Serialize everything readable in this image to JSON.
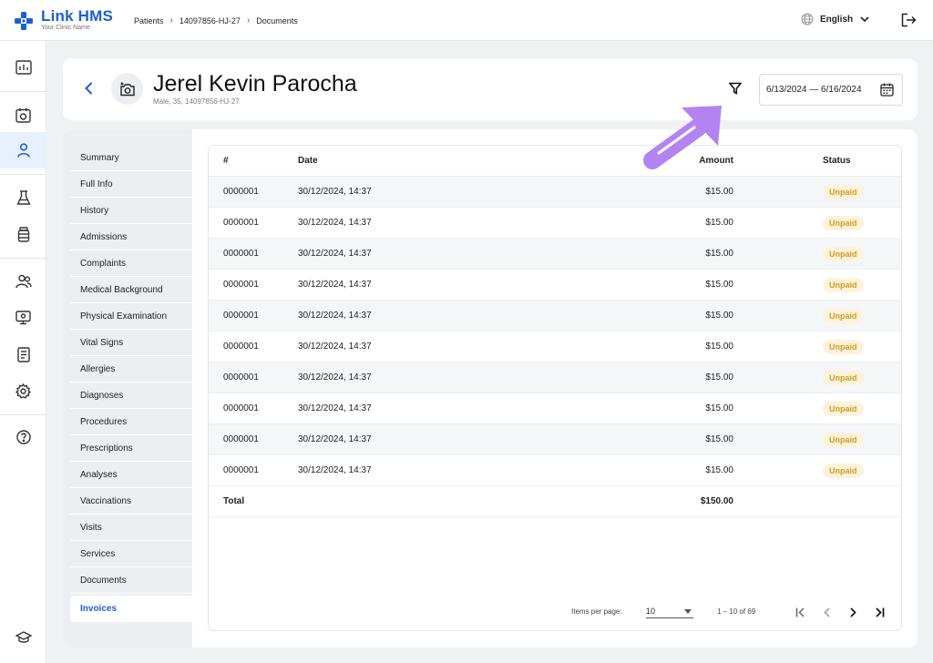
{
  "app": {
    "name": "Link HMS",
    "subtitle": "Your Clinic Name",
    "brand_color": "#1c5fd4"
  },
  "breadcrumb": [
    "Patients",
    "14097856-HJ-27",
    "Documents"
  ],
  "language": "English",
  "patient": {
    "name": "Jerel Kevin Parocha",
    "meta": "Male, 35, 14097856-HJ-27"
  },
  "date_range": "6/13/2024 — 6/16/2024",
  "sidebar": [
    "dashboard-icon",
    "calendar-icon",
    "user-icon",
    "lab-flask-icon",
    "medicine-bottle-icon",
    "users-icon",
    "monitor-icon",
    "report-icon",
    "settings-icon",
    "help-icon",
    "graduation-cap-icon"
  ],
  "subnav": [
    "Summary",
    "Full Info",
    "History",
    "Admissions",
    "Complaints",
    "Medical Background",
    "Physical Examination",
    "Vital Signs",
    "Allergies",
    "Diagnoses",
    "Procedures",
    "Prescriptions",
    "Analyses",
    "Vaccinations",
    "Visits",
    "Services",
    "Documents",
    "Invoices"
  ],
  "subnav_active": "Invoices",
  "table": {
    "headers": {
      "num": "#",
      "date": "Date",
      "amount": "Amount",
      "status": "Status"
    },
    "rows": [
      {
        "num": "0000001",
        "date": "30/12/2024, 14:37",
        "amount": "$15.00",
        "status": "Unpaid"
      },
      {
        "num": "0000001",
        "date": "30/12/2024, 14:37",
        "amount": "$15.00",
        "status": "Unpaid"
      },
      {
        "num": "0000001",
        "date": "30/12/2024, 14:37",
        "amount": "$15.00",
        "status": "Unpaid"
      },
      {
        "num": "0000001",
        "date": "30/12/2024, 14:37",
        "amount": "$15.00",
        "status": "Unpaid"
      },
      {
        "num": "0000001",
        "date": "30/12/2024, 14:37",
        "amount": "$15.00",
        "status": "Unpaid"
      },
      {
        "num": "0000001",
        "date": "30/12/2024, 14:37",
        "amount": "$15.00",
        "status": "Unpaid"
      },
      {
        "num": "0000001",
        "date": "30/12/2024, 14:37",
        "amount": "$15.00",
        "status": "Unpaid"
      },
      {
        "num": "0000001",
        "date": "30/12/2024, 14:37",
        "amount": "$15.00",
        "status": "Unpaid"
      },
      {
        "num": "0000001",
        "date": "30/12/2024, 14:37",
        "amount": "$15.00",
        "status": "Unpaid"
      },
      {
        "num": "0000001",
        "date": "30/12/2024, 14:37",
        "amount": "$15.00",
        "status": "Unpaid"
      }
    ],
    "total_label": "Total",
    "total_amount": "$150.00"
  },
  "pagination": {
    "items_per_page_label": "Items per page:",
    "items_per_page": "10",
    "range": "1 – 10 of 69"
  },
  "colors": {
    "status_unpaid_bg": "#fdf3dc",
    "status_unpaid_text": "#d69a1d",
    "overlay_arrow": "#b383f2"
  }
}
